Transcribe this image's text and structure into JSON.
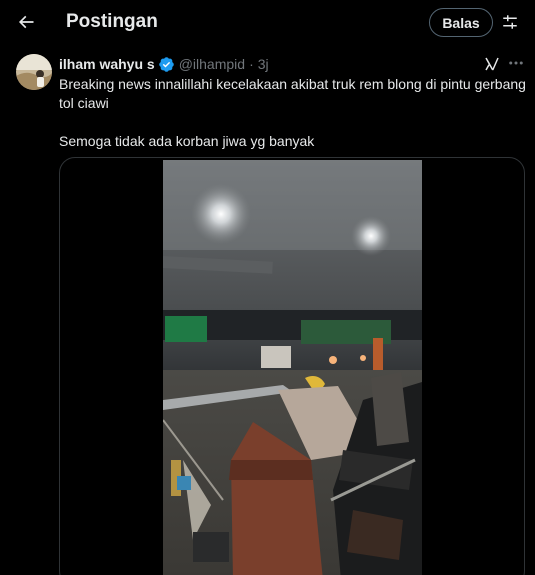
{
  "header": {
    "title": "Postingan",
    "reply_label": "Balas",
    "back_icon": "arrow-left-icon",
    "filter_icon": "sliders-icon"
  },
  "post": {
    "display_name": "ilham wahyu s",
    "handle": "@ilhampid",
    "separator": "·",
    "time": "3j",
    "verified_color": "#1d9bf0",
    "text_lines": [
      "Breaking news innalillahi kecelakaan akibat truk rem blong di pintu gerbang tol ciawi",
      "Semoga tidak ada korban jiwa yg banyak"
    ]
  },
  "colors": {
    "background": "#000000",
    "text_primary": "#e7e9ea",
    "text_secondary": "#71767b",
    "border": "#2f3336",
    "accent": "#1d9bf0"
  }
}
